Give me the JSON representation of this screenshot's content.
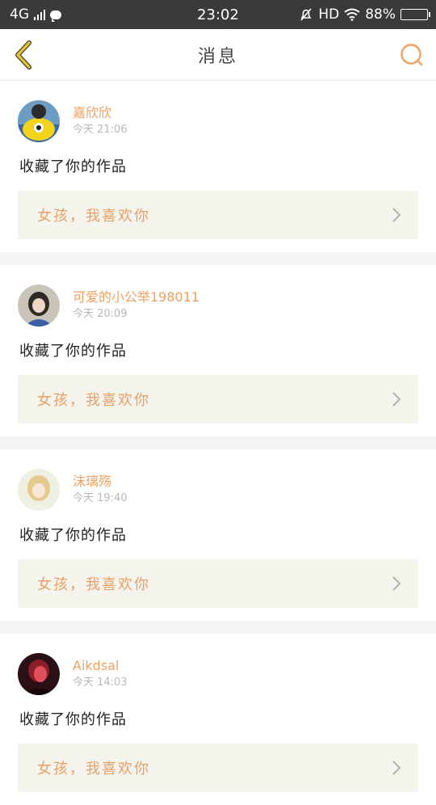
{
  "status": {
    "network": "4G",
    "time": "23:02",
    "hd": "HD",
    "battery": "88%",
    "battery_fill": 0.88
  },
  "header": {
    "title": "消息",
    "back_icon": "chevron-left-icon",
    "search_icon": "search-icon"
  },
  "colors": {
    "accent": "#f0a060",
    "back": "#e8c23a"
  },
  "messages": [
    {
      "username": "嘉欣欣",
      "time": "今天 21:06",
      "action": "收藏了你的作品",
      "work": "女孩，我喜欢你"
    },
    {
      "username": "可爱的小公举198011",
      "time": "今天 20:09",
      "action": "收藏了你的作品",
      "work": "女孩，我喜欢你"
    },
    {
      "username": "沫璃殇",
      "time": "今天 19:40",
      "action": "收藏了你的作品",
      "work": "女孩，我喜欢你"
    },
    {
      "username": "Aikdsal",
      "time": "今天 14:03",
      "action": "收藏了你的作品",
      "work": "女孩，我喜欢你"
    }
  ]
}
